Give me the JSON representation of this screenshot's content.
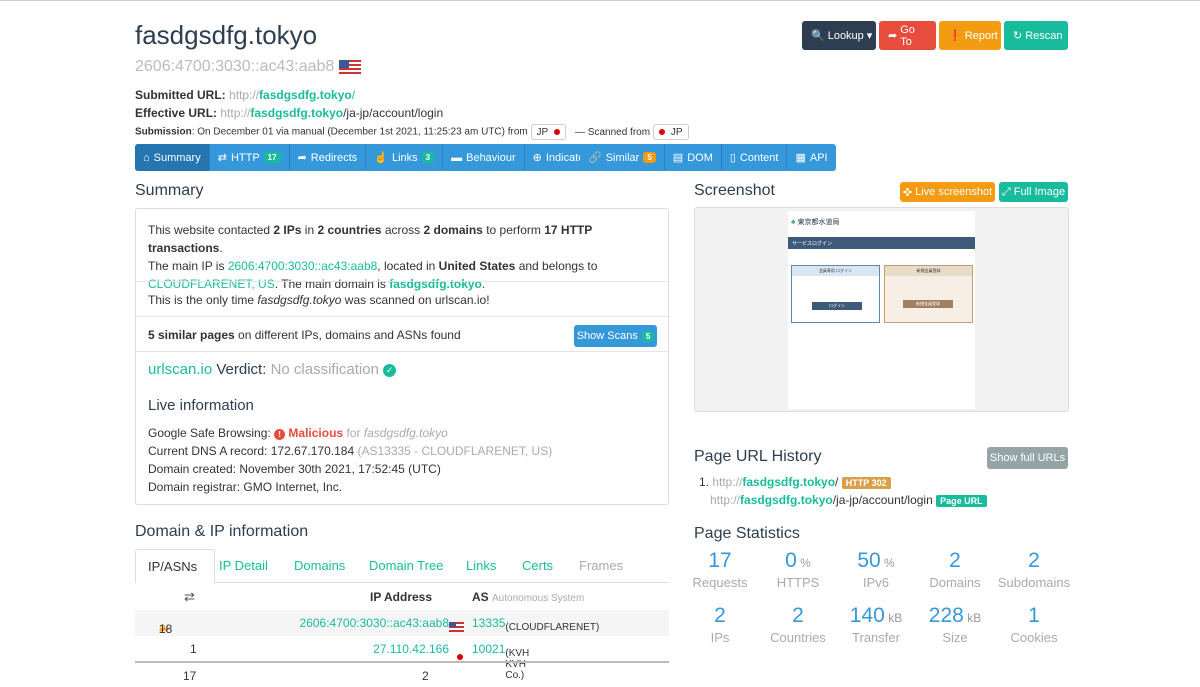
{
  "header": {
    "domain": "fasdgsdfg.tokyo",
    "ip": "2606:4700:3030::ac43:aab8",
    "submitted_label": "Submitted URL",
    "submitted_prefix": "http://",
    "submitted_host": "fasdgsdfg.tokyo",
    "submitted_path": "/",
    "effective_label": "Effective URL",
    "effective_prefix": "http://",
    "effective_host": "fasdgsdfg.tokyo",
    "effective_path": "/ja-jp/account/login",
    "submission_label": "Submission",
    "submission_text": "On December 01 via manual (December 1st 2021, 11:25:23 am UTC) from",
    "from_country": "JP",
    "scanned_from_text": "— Scanned from",
    "scanned_country": "JP"
  },
  "actions": {
    "lookup": "Lookup",
    "goto": "Go To",
    "report": "Report",
    "rescan": "Rescan"
  },
  "tabs": [
    {
      "label": "Summary"
    },
    {
      "label": "HTTP",
      "badge": "17"
    },
    {
      "label": "Redirects"
    },
    {
      "label": "Links",
      "badge": "3"
    },
    {
      "label": "Behaviour"
    },
    {
      "label": "Indicators"
    }
  ],
  "tabs2": [
    {
      "label": "Similar",
      "badge": "5"
    },
    {
      "label": "DOM"
    },
    {
      "label": "Content"
    },
    {
      "label": "API"
    }
  ],
  "summary": {
    "title": "Summary",
    "p1_a": "This website contacted ",
    "ips": "2 IPs",
    "p1_b": " in ",
    "countries": "2 countries",
    "p1_c": " across ",
    "domains": "2 domains",
    "p1_d": " to perform ",
    "txn": "17 HTTP transactions",
    "p1_e": ".",
    "p2_a": "The main IP is ",
    "main_ip": "2606:4700:3030::ac43:aab8",
    "p2_b": ", located in ",
    "location": "United States",
    "p2_c": " and belongs to",
    "asn": "CLOUDFLARENET, US",
    "p3_a": ". The main domain is ",
    "main_domain": "fasdgsdfg.tokyo",
    "p3_b": ".",
    "only_a": "This is the only time ",
    "only_dom": "fasdgsdfg.tokyo",
    "only_b": " was scanned on urlscan.io!",
    "similar_bold": "5 similar pages",
    "similar_rest": " on different IPs, domains and ASNs found",
    "show_scans": "Show Scans",
    "show_scans_badge": "5",
    "verdict_brand": "urlscan.io",
    "verdict_label": " Verdict: ",
    "verdict_value": "No classification",
    "live_title": "Live information",
    "gsb_label": "Google Safe Browsing: ",
    "gsb_value": "Malicious",
    "gsb_for": " for ",
    "gsb_dom": "fasdgsdfg.tokyo",
    "dns_label": "Current DNS A record: ",
    "dns_ip": "172.67.170.184",
    "dns_as": " (AS13335 - CLOUDFLARENET, US)",
    "created": "Domain created: November 30th 2021, 17:52:45 (UTC)",
    "registrar": "Domain registrar: GMO Internet, Inc."
  },
  "screenshot": {
    "title": "Screenshot",
    "live": "Live screenshot",
    "full": "Full Image",
    "site_title": "東京都水道局",
    "bar": "サービスログイン",
    "login_head": "会員専用 ログイン",
    "reg_head": "新規会員登録",
    "login_btn": "ログイン",
    "reg_btn": "新規会員登録"
  },
  "history": {
    "title": "Page URL History",
    "show_full": "Show full URLs",
    "items": [
      {
        "prefix": "http://",
        "host": "fasdgsdfg.tokyo",
        "path": "/",
        "tag": "HTTP 302"
      },
      {
        "prefix": "http://",
        "host": "fasdgsdfg.tokyo",
        "path": "/ja-jp/account/login",
        "tag": "Page URL"
      }
    ]
  },
  "stats": {
    "title": "Page Statistics",
    "items": [
      {
        "n": "17",
        "u": "",
        "l": "Requests"
      },
      {
        "n": "0",
        "u": "%",
        "l": "HTTPS"
      },
      {
        "n": "50",
        "u": "%",
        "l": "IPv6"
      },
      {
        "n": "2",
        "u": "",
        "l": "Domains"
      },
      {
        "n": "2",
        "u": "",
        "l": "Subdomains"
      },
      {
        "n": "2",
        "u": "",
        "l": "IPs"
      },
      {
        "n": "2",
        "u": "",
        "l": "Countries"
      },
      {
        "n": "140",
        "u": "kB",
        "l": "Transfer"
      },
      {
        "n": "228",
        "u": "kB",
        "l": "Size"
      },
      {
        "n": "1",
        "u": "",
        "l": "Cookies"
      }
    ]
  },
  "domainip": {
    "title": "Domain & IP information",
    "tabs": [
      "IP/ASNs",
      "IP Detail",
      "Domains",
      "Domain Tree",
      "Links",
      "Certs",
      "Frames"
    ],
    "col_ip": "IP Address",
    "col_as": "AS",
    "col_as_sub": "Autonomous System",
    "rows": [
      {
        "redir": "2",
        "count": "18",
        "ip": "2606:4700:3030::ac43:aab8",
        "as_num": "13335",
        "as_name": "(CLOUDFLARENET)"
      },
      {
        "redir": "",
        "count": "1",
        "ip": "27.110.42.166",
        "as_num": "10021",
        "as_name": "(KVH KVH Co.)"
      }
    ],
    "total_count": "17",
    "total_ips": "2"
  }
}
